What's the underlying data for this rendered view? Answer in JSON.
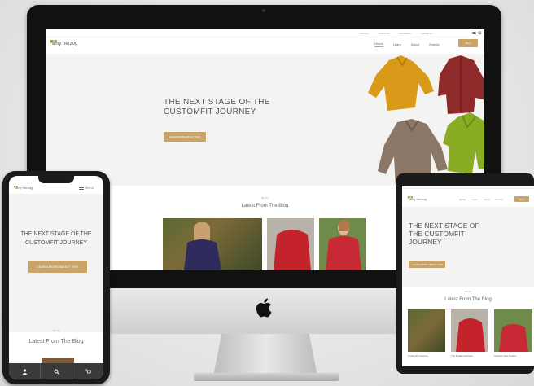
{
  "site": {
    "logo_text": "amy herzog",
    "util_links": [
      "Account",
      "CustomFit",
      "Newsletter",
      "Contact Us"
    ],
    "nav": [
      "Home",
      "Learn",
      "About",
      "Events"
    ],
    "nav_cta": "Shop",
    "hero_title": "THE NEXT STAGE OF THE CUSTOMFIT JOURNEY",
    "hero_cta": "LEARN MORE ABOUT THIS",
    "blog_kicker": "BLOG",
    "blog_title": "Latest From The Blog"
  },
  "tablet": {
    "hero_title": "THE NEXT STAGE OF THE CUSTOMFIT JOURNEY",
    "cta": "LEARN MORE ABOUT THIS",
    "blog_kicker": "BLOG",
    "blog_title": "Latest From The Blog",
    "posts": [
      "CustomFit Journey",
      "The Raglan Refresh",
      "Another New Design"
    ]
  },
  "phone": {
    "menu_label": "Menu",
    "hero_title_line1": "THE NEXT STAGE OF THE",
    "hero_title_line2": "CUSTOMFIT JOURNEY",
    "cta": "LEARN MORE ABOUT THIS",
    "blog_kicker": "BLOG",
    "blog_title": "Latest From The Blog",
    "tab_icons": [
      "user-icon",
      "search-icon",
      "cart-icon"
    ]
  },
  "colors": {
    "accent": "#c9a46a",
    "sweater_yellow": "#d99a1a",
    "sweater_red": "#8f2a2a",
    "sweater_gray": "#8a7768",
    "sweater_green": "#8aac25"
  }
}
